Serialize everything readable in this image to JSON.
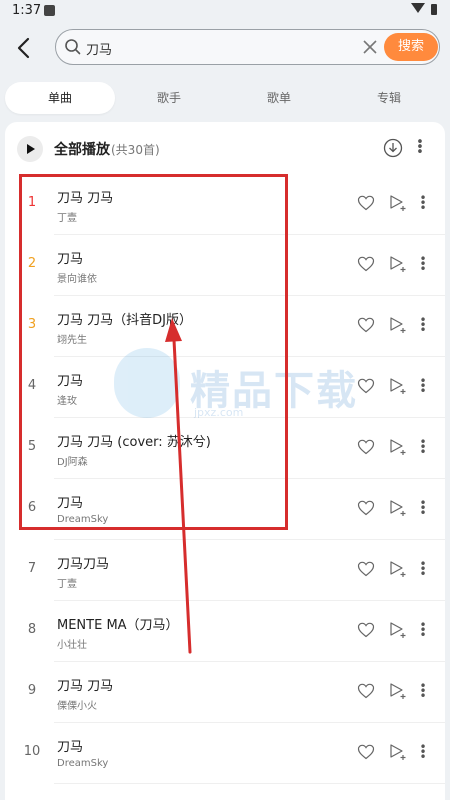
{
  "status": {
    "time": "1:37"
  },
  "search": {
    "value": "刀马",
    "button_label": "搜索"
  },
  "tabs": [
    {
      "label": "单曲",
      "active": true
    },
    {
      "label": "歌手",
      "active": false
    },
    {
      "label": "歌单",
      "active": false
    },
    {
      "label": "专辑",
      "active": false
    }
  ],
  "playall": {
    "label": "全部播放",
    "count": "(共30首)"
  },
  "songs": [
    {
      "rank": "1",
      "title": "刀马 刀马",
      "artist": "丁壹"
    },
    {
      "rank": "2",
      "title": "刀马",
      "artist": "景向谁依"
    },
    {
      "rank": "3",
      "title": "刀马  刀马（抖音DJ版）",
      "artist": "翊先生"
    },
    {
      "rank": "4",
      "title": "刀马",
      "artist": "逢玫"
    },
    {
      "rank": "5",
      "title": "刀马 刀马 (cover: 苏沐兮)",
      "artist": "DJ阿森"
    },
    {
      "rank": "6",
      "title": "刀马",
      "artist": "DreamSky"
    },
    {
      "rank": "7",
      "title": "刀马刀马",
      "artist": "丁壹"
    },
    {
      "rank": "8",
      "title": "MENTE MA（刀马）",
      "artist": "小壮壮"
    },
    {
      "rank": "9",
      "title": "刀马 刀马",
      "artist": "傈傈小火"
    },
    {
      "rank": "10",
      "title": "刀马",
      "artist": "DreamSky"
    }
  ],
  "watermark": {
    "text": "精品下载",
    "url": "jpxz.com"
  },
  "colors": {
    "accent": "#ff8a3d",
    "rank1": "#ee3333",
    "rank2_3": "#f0a020",
    "annotation": "#d62d2d"
  }
}
